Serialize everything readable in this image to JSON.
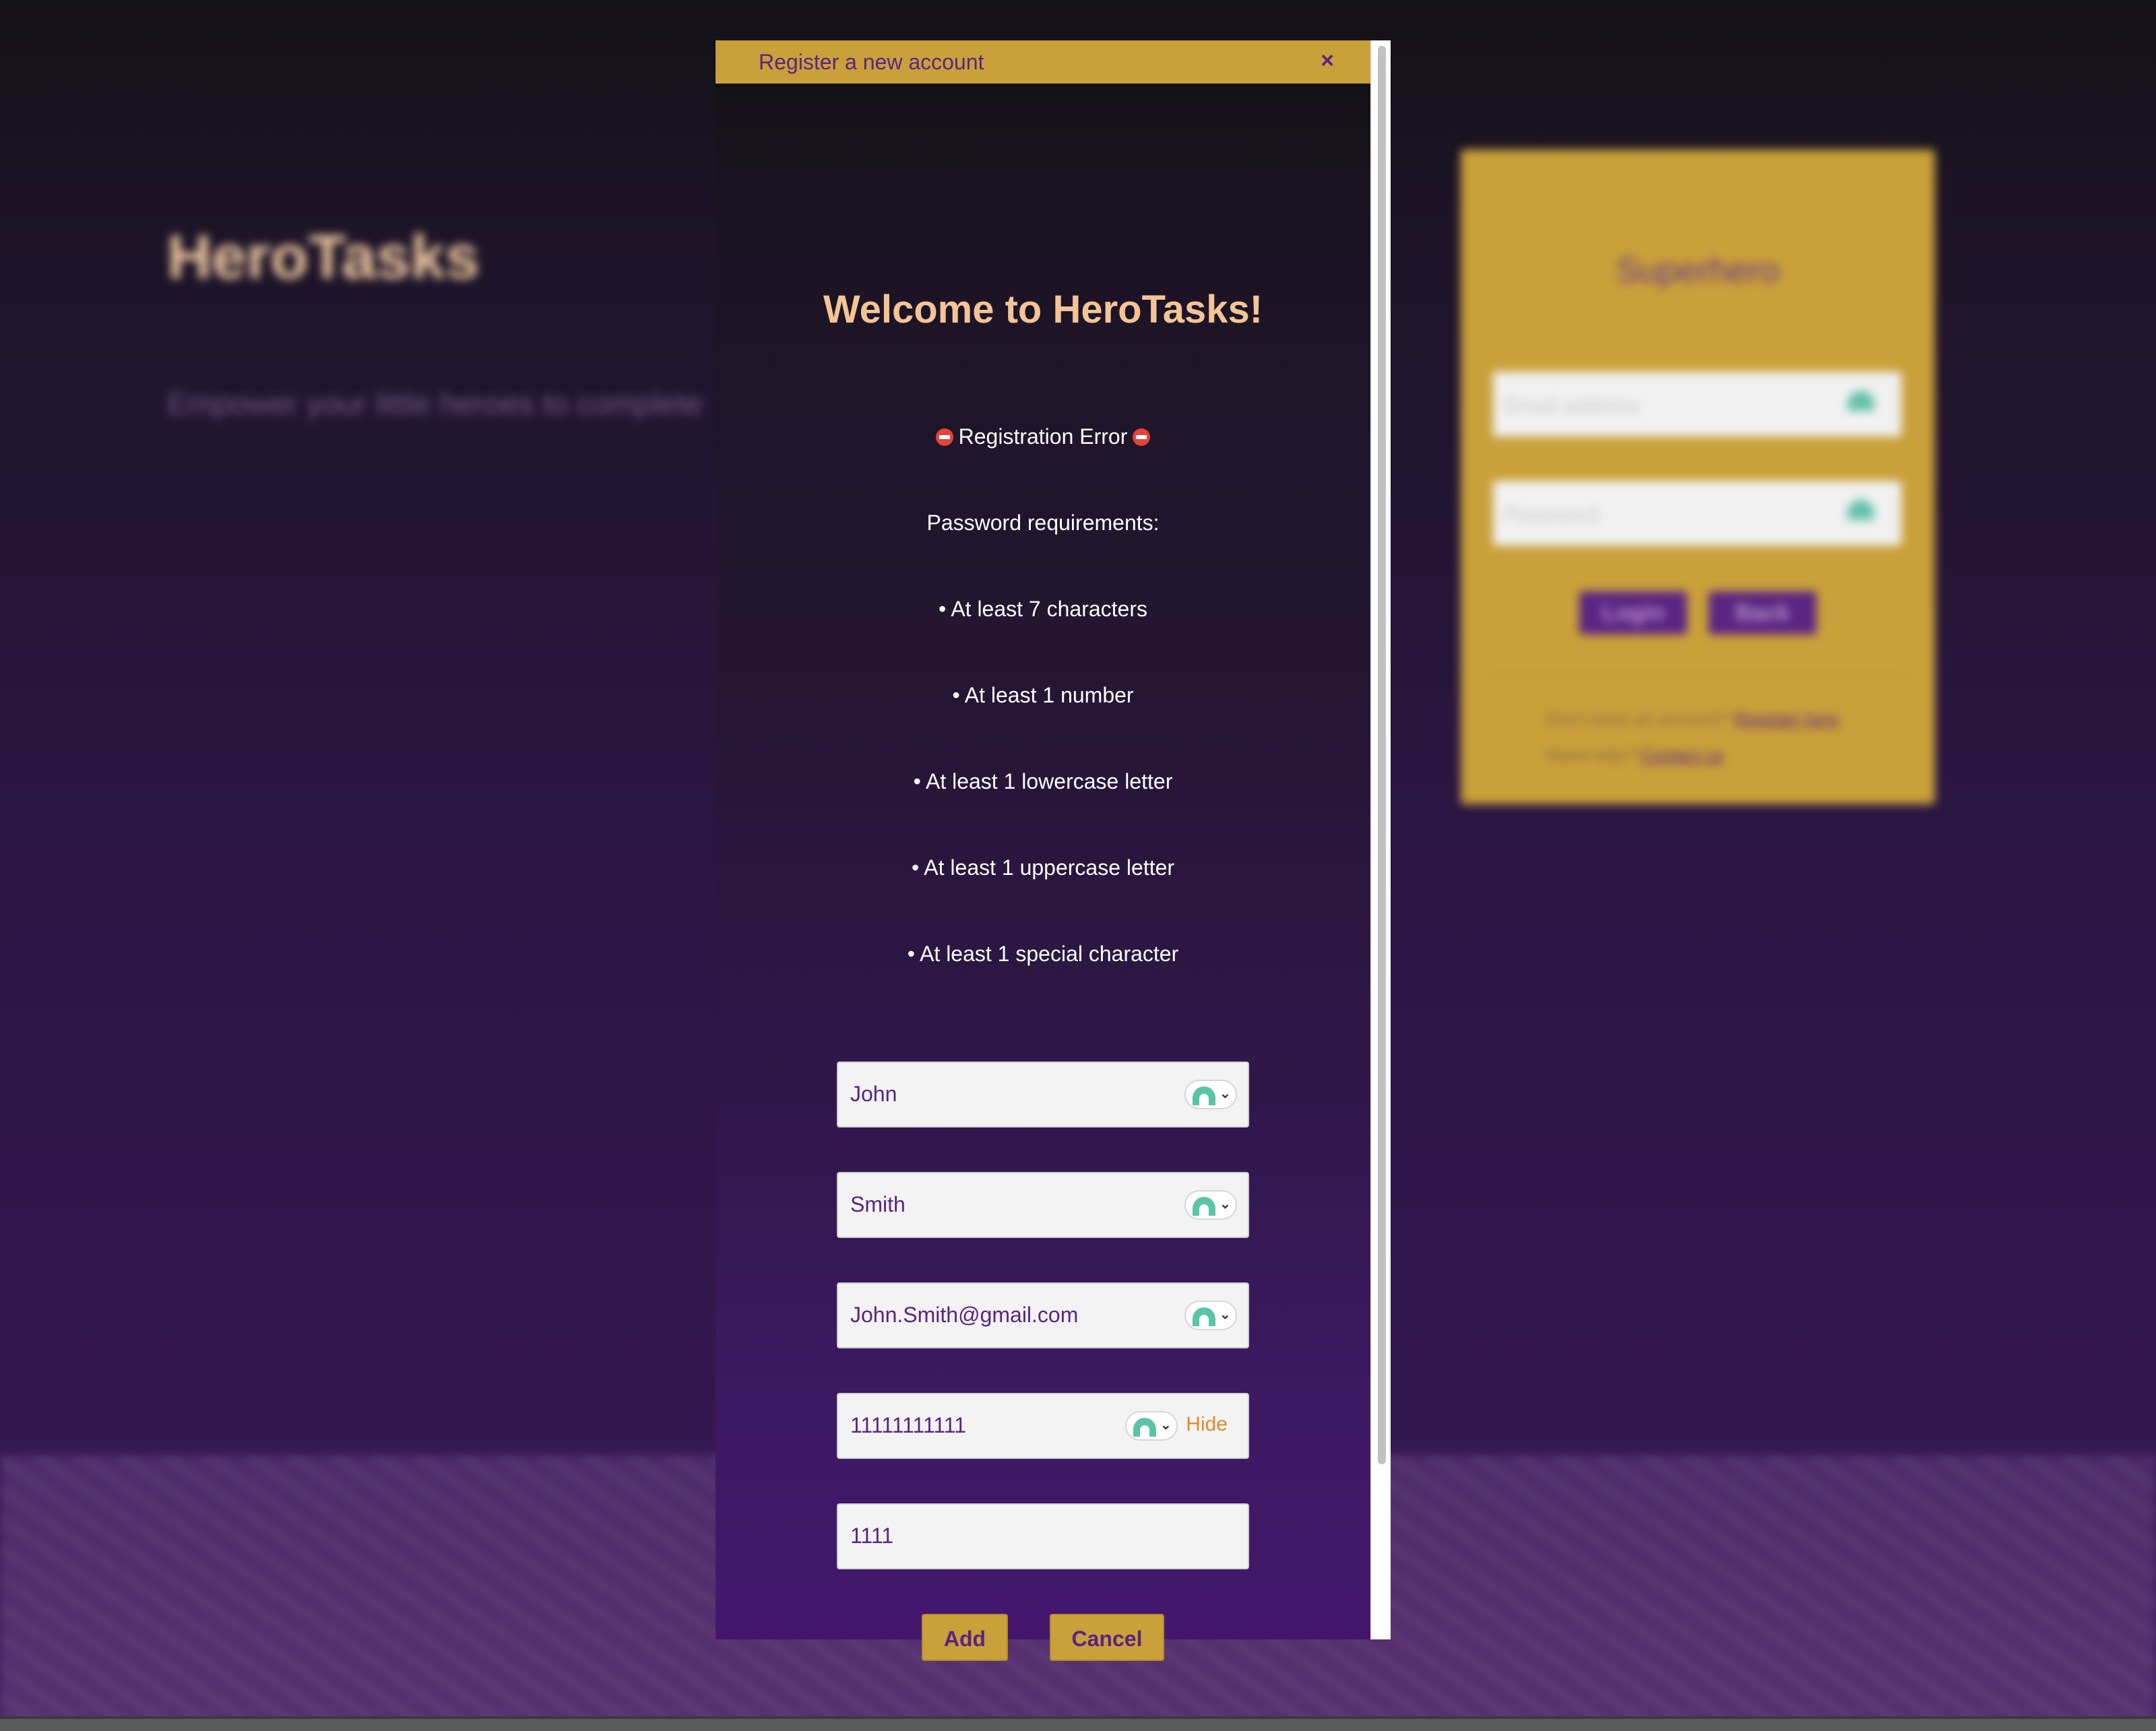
{
  "background_page": {
    "title": "HeroTasks",
    "tagline": "Empower your little heroes to complete",
    "login_card": {
      "title": "Superhero",
      "email_placeholder": "Email address",
      "password_placeholder": "Password",
      "login_label": "Login",
      "back_label": "Back",
      "register_prompt": "Don't have an account?",
      "register_link": "Register here",
      "help_prompt": "Need help?",
      "help_link": "Contact us"
    }
  },
  "modal": {
    "title": "Register a new account",
    "close_symbol": "×",
    "heading": "Welcome to HeroTasks!",
    "error": {
      "title": "Registration Error",
      "requirements_heading": "Password requirements:",
      "requirements": [
        "• At least 7 characters",
        "• At least 1 number",
        "• At least 1 lowercase letter",
        "• At least 1 uppercase letter",
        "• At least 1 special character"
      ]
    },
    "fields": {
      "first_name": "John",
      "last_name": "Smith",
      "email": "John.Smith@gmail.com",
      "password": "11111111111",
      "password_toggle": "Hide",
      "confirm_password": "1111"
    },
    "add_label": "Add",
    "cancel_label": "Cancel"
  },
  "colors": {
    "gold": "#caa03a",
    "purple": "#5a2483",
    "peach": "#f4c497",
    "orange_link": "#e0892b",
    "password_manager_green": "#5bc3a6"
  },
  "icons": [
    "close-icon",
    "no-entry-icon",
    "password-manager-icon",
    "chevron-down-icon"
  ]
}
